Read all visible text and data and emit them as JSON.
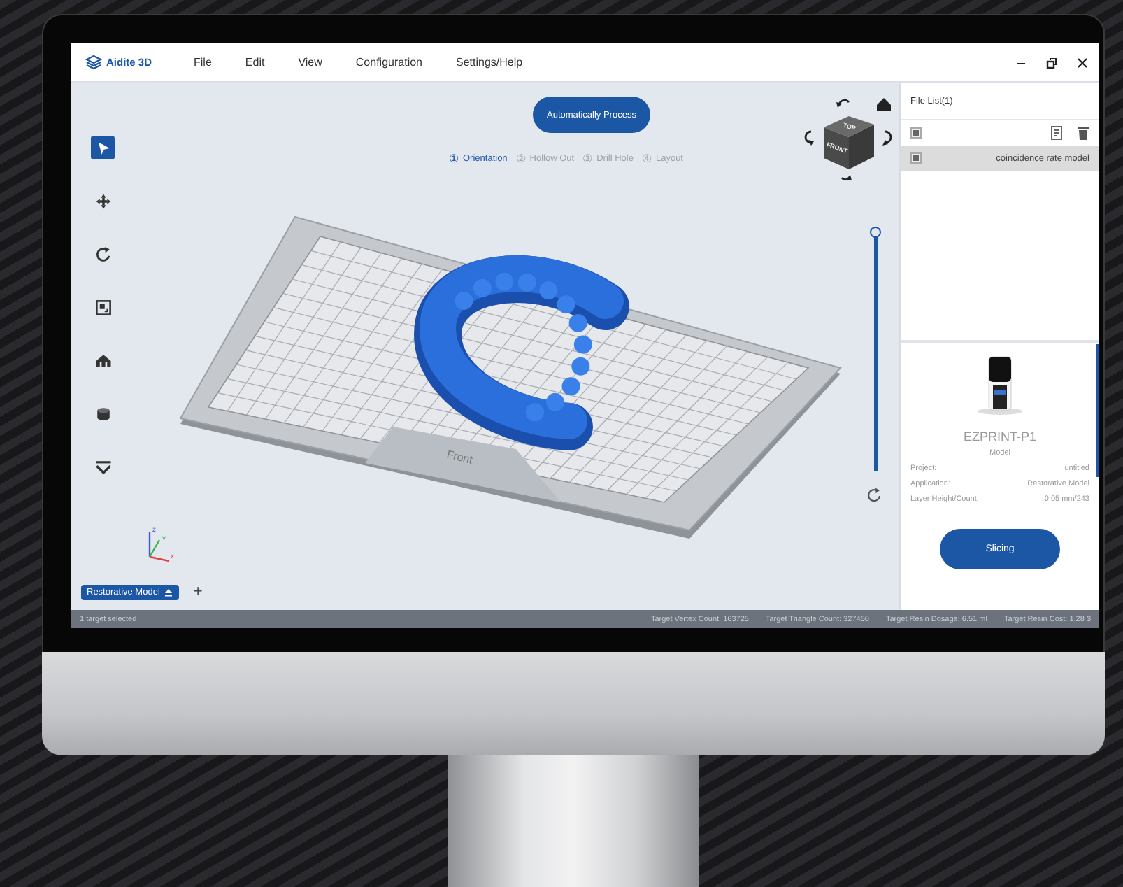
{
  "app": {
    "logo": "Aidite 3D",
    "menu": [
      "File",
      "Edit",
      "View",
      "Configuration",
      "Settings/Help"
    ]
  },
  "toolbar": [
    {
      "kind": "select",
      "selected": true
    },
    {
      "kind": "move",
      "selected": false
    },
    {
      "kind": "rotate",
      "selected": false
    },
    {
      "kind": "scale",
      "selected": false
    },
    {
      "kind": "support",
      "selected": false
    },
    {
      "kind": "base",
      "selected": false
    },
    {
      "kind": "collapse",
      "selected": false
    }
  ],
  "process_button": "Automatically Process",
  "steps": [
    {
      "number": "①",
      "label": "Orientation",
      "selected": true
    },
    {
      "number": "②",
      "label": "Hollow Out",
      "selected": false
    },
    {
      "number": "③",
      "label": "Drill Hole",
      "selected": false
    },
    {
      "number": "④",
      "label": "Layout",
      "selected": false
    }
  ],
  "view_cube": {
    "top_face": "TOP",
    "front_face": "FRONT"
  },
  "build_plate": {
    "label": "Front"
  },
  "axis_labels": [
    "z",
    "y",
    "x"
  ],
  "layer_slider": {
    "level": 1
  },
  "model_tabs": [
    {
      "label": "Restorative Model",
      "selected": true
    }
  ],
  "add_tab": "+",
  "file_list": {
    "title": "File List(1)",
    "all_checked": true,
    "files": [
      {
        "name": "coincidence rate model",
        "checked": true,
        "selected": true
      }
    ]
  },
  "printer": {
    "name": "EZPRINT-P1",
    "section": "Model",
    "details": [
      {
        "label": "Project:",
        "value": "untitled"
      },
      {
        "label": "Application:",
        "value": "Restorative Model"
      },
      {
        "label": "Layer Height/Count:",
        "value": "0.05 mm/243"
      }
    ]
  },
  "slicing_button": "Slicing",
  "status_bar": {
    "selection": "1 target selected",
    "stats": [
      {
        "label": "Target Vertex Count:",
        "value": "163725"
      },
      {
        "label": "Target Triangle Count:",
        "value": "327450"
      },
      {
        "label": "Target Resin Dosage:",
        "value": "6.51 ml"
      },
      {
        "label": "Target Resin Cost:",
        "value": "1.28 $"
      }
    ]
  }
}
